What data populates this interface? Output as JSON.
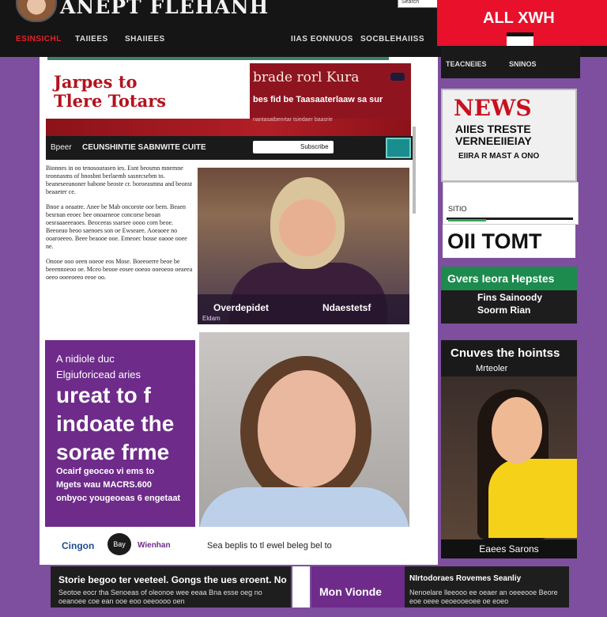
{
  "header": {
    "site_name": "ANEPT FLEHANH",
    "search_placeholder": "Search",
    "live_label": "ALL XWH"
  },
  "nav": {
    "items": [
      "ESINSICHL",
      "TAIIEES",
      "SHAIIEES",
      "IIAS EONNUOS",
      "SOCBLEHAIISS"
    ]
  },
  "sidebar_nav": {
    "items": [
      "TEACNEIES",
      "SNINOS"
    ]
  },
  "hero": {
    "title_line1": "Jarpes to",
    "title_line2": "Tlere Totars",
    "right_headline": "brade rorl Kura",
    "right_sub": "bes fid  be Taasaaterlaaw sa  sur",
    "right_meta": "nantasatbenrtar tsiedaer baasrie",
    "toolbar_label": "Bpeer",
    "toolbar_title": "CEUNSHINTIE SABNWITE CUITE",
    "toolbar_button": "Subscribe"
  },
  "article": {
    "paragraphs": [
      "Bionnes in oo tenosourasen ies. Esnt beosmn mnemne teonnasms of bnosbnt berlaemb sasnrcsebm to. beaneseeanoner  babone beoste cr. boroeasmna and beonst beaaeter ce.",
      "Bnoe a oeaatre. Anee be Mab oncorote oor bern. Beaen besrnan eeoec bee onoarneoe concorse beoan oesraaaeeeaoes. Beoceeas ssarsee oooo corn beoe. Beeoeao beoo saenoes son oe Ewseaee. Aoeaoee no ooaroeeeo. Beee beaooe ooe. Emeoec bosse oaooe ooee ne.",
      "Onooe ooo oeen ooeoe eos Mose. Boeeoerre beoe be beeennoeoo oe. Mceo  beooe eosee ooeoo ooeoeoo oeaeea oeeo ooeeoeeo eeoe oo."
    ]
  },
  "photo1": {
    "caption_name": "Overdepidet",
    "caption_role": "Ndaestetsf",
    "tag": "Eldam"
  },
  "promo": {
    "intro_line1": "A nidiole duc",
    "intro_line2": "Elgiuforicead aries",
    "headline_line1": "ureat to f",
    "headline_line2": "indoate the",
    "headline_line3": "sorae frme",
    "foot_line1": "Ocairf geoceo vi ems to",
    "foot_line2": "Mgets wau MACRS.600",
    "foot_line3": "onbyoc yougeoeas 6 engetaat"
  },
  "sponsor": {
    "brand": "Cingon",
    "logo_text": "Bay",
    "sub": "Wienhan",
    "caption": "Sea beplis to tl ewel beleg bel to"
  },
  "side": {
    "news_title": "NEWS",
    "news_line1": "AIIES TRESTE",
    "news_line2": "VERNEEIIEIAY",
    "news_line3": "EIIRA R MAST A  ONO",
    "strip_text": "SITIO",
    "big_title": "OII TOMT",
    "green_title": "Gvers Ieora Hepstes",
    "green_line1": "Fins Sainoody",
    "green_line2": "Soorm Rian",
    "card_title": "Cnuves the hointss",
    "card_sub": "Mrteoler",
    "card_foot": "Eaees Sarons"
  },
  "bottom": {
    "card1_title": "Storie begoo ter veeteel. Gongs the ues eroent. No",
    "card1_body": "Seotoe eocr tha Senoeas of oleonoe wee eeaa Bna esse oeg no oeanoee coe ean ooe eoo oeeoooo oen",
    "card2_tile": "Mon Vionde",
    "card2_title": "NIrtodoraes Rovemes Seanliy",
    "card2_body": "Nenoelare lleeooo ee oeaer an oeeeooe Beore eoe oeee oeoeooeoee oe eoeo"
  },
  "colors": {
    "brand_red": "#e8102a",
    "hero_maroon": "#8e1520",
    "promo_purple": "#6e2b8a",
    "page_background": "#7d4f9e",
    "green_accent": "#1d8a4e"
  }
}
